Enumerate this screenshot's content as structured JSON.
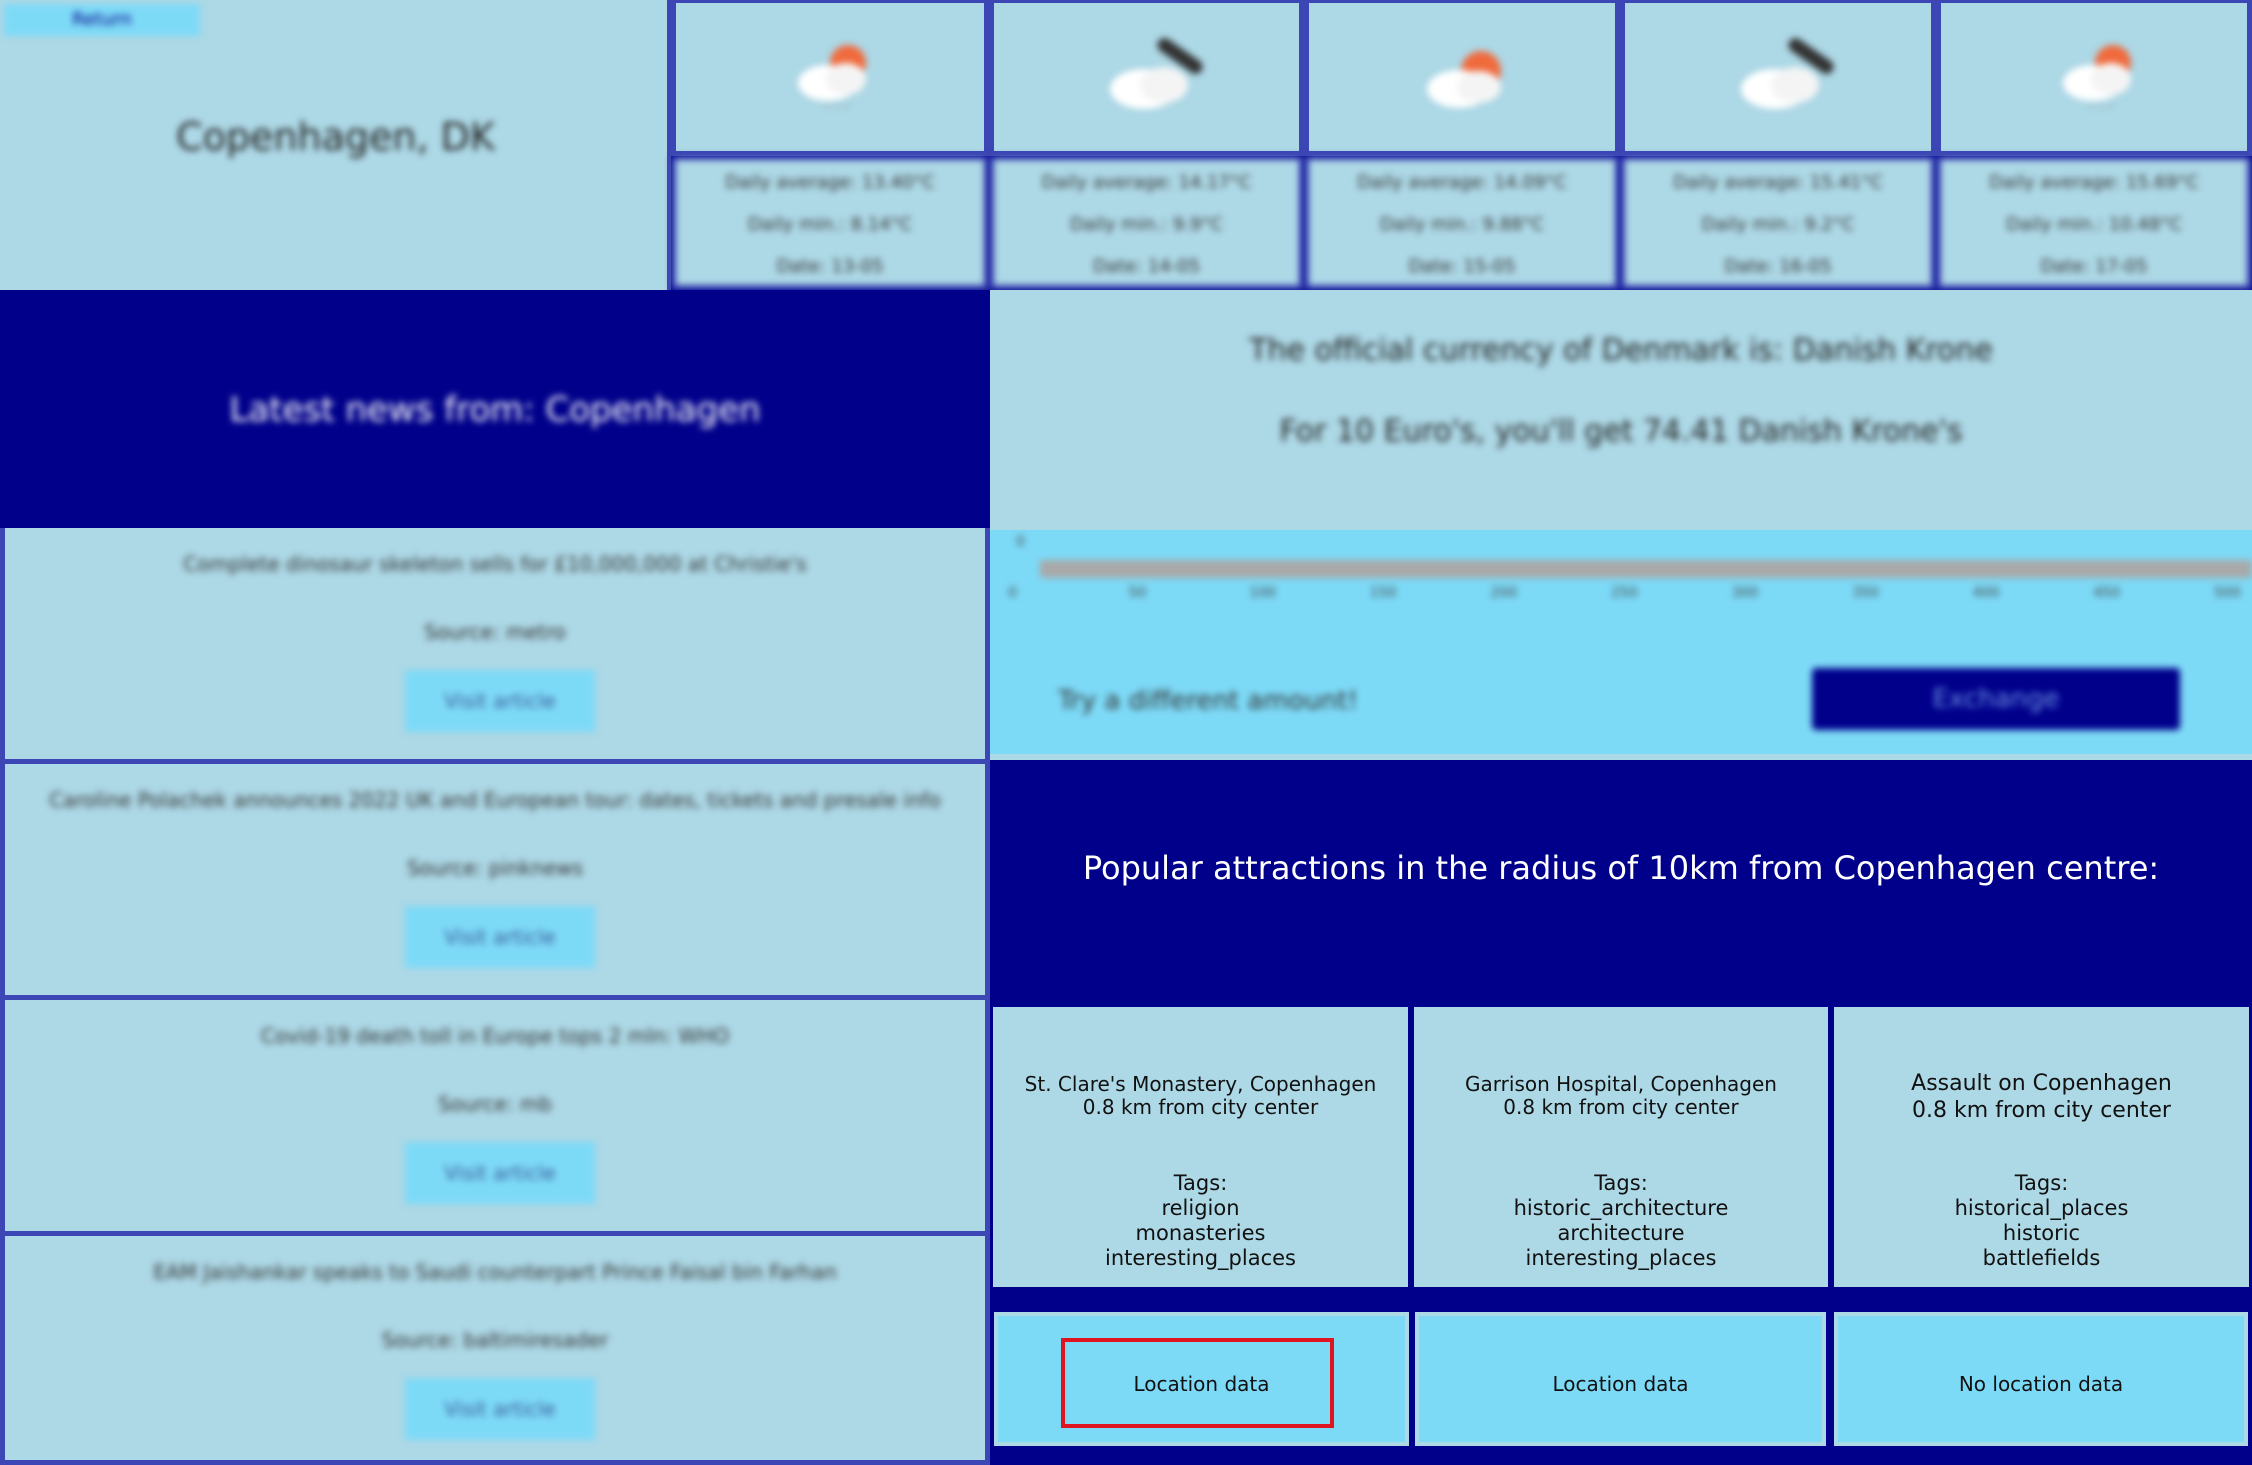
{
  "header": {
    "return_label": "Return",
    "city": "Copenhagen, DK"
  },
  "weather": [
    {
      "icon": "sun-behind-cloud-rain-icon",
      "avg": "Daily average: 13.40°C",
      "min": "Daily min.: 8.14°C",
      "date": "Date: 13-05"
    },
    {
      "icon": "cloud-umbrella-icon",
      "avg": "Daily average: 14.17°C",
      "min": "Daily min.: 9.9°C",
      "date": "Date: 14-05"
    },
    {
      "icon": "sun-behind-cloud-icon",
      "avg": "Daily average: 14.09°C",
      "min": "Daily min.: 9.88°C",
      "date": "Date: 15-05"
    },
    {
      "icon": "cloud-umbrella-icon",
      "avg": "Daily average: 15.41°C",
      "min": "Daily min.: 9.2°C",
      "date": "Date: 16-05"
    },
    {
      "icon": "sun-behind-cloud-rain-icon",
      "avg": "Daily average: 15.69°C",
      "min": "Daily min.: 10.48°C",
      "date": "Date: 17-05"
    }
  ],
  "news": {
    "title": "Latest news from: Copenhagen",
    "button_label": "Visit article",
    "articles": [
      {
        "title": "Complete dinosaur skeleton sells for £10,000,000 at Christie's",
        "source": "Source: metro"
      },
      {
        "title": "Caroline Polachek announces 2022 UK and European tour: dates, tickets and presale info",
        "source": "Source: pinknews"
      },
      {
        "title": "Covid-19 death toll in Europe tops 2 mln: WHO",
        "source": "Source: mb"
      },
      {
        "title": "EAM Jaishankar speaks to Saudi counterpart Prince Faisal bin Farhan",
        "source": "Source: baltimiresader"
      }
    ]
  },
  "currency": {
    "line1": "The official currency of Denmark is: Danish Krone",
    "line2": "For 10 Euro's, you'll get 74.41 Danish Krone's",
    "slider_value": "0",
    "ticks": [
      "0",
      "50",
      "100",
      "150",
      "200",
      "250",
      "300",
      "350",
      "400",
      "450",
      "500"
    ],
    "try_label": "Try a different amount!",
    "exchange_label": "Exchange"
  },
  "attractions": {
    "title": "Popular attractions in the radius of 10km from Copenhagen centre:",
    "items": [
      {
        "name": "St. Clare's Monastery, Copenhagen",
        "distance": "0.8 km from city center",
        "tags_label": "Tags:",
        "tags": [
          "religion",
          "monasteries",
          "interesting_places"
        ],
        "button": "Location data"
      },
      {
        "name": "Garrison Hospital, Copenhagen",
        "distance": "0.8 km from city center",
        "tags_label": "Tags:",
        "tags": [
          "historic_architecture",
          "architecture",
          "interesting_places"
        ],
        "button": "Location data"
      },
      {
        "name": "Assault on Copenhagen",
        "distance": "0.8 km from city center",
        "tags_label": "Tags:",
        "tags": [
          "historical_places",
          "historic",
          "battlefields"
        ],
        "button": "No location data"
      }
    ]
  },
  "colors": {
    "navy": "#00008b",
    "light_blue": "#add8e6",
    "sky_blue": "#7ddaf7",
    "highlight": "#e0141e"
  }
}
